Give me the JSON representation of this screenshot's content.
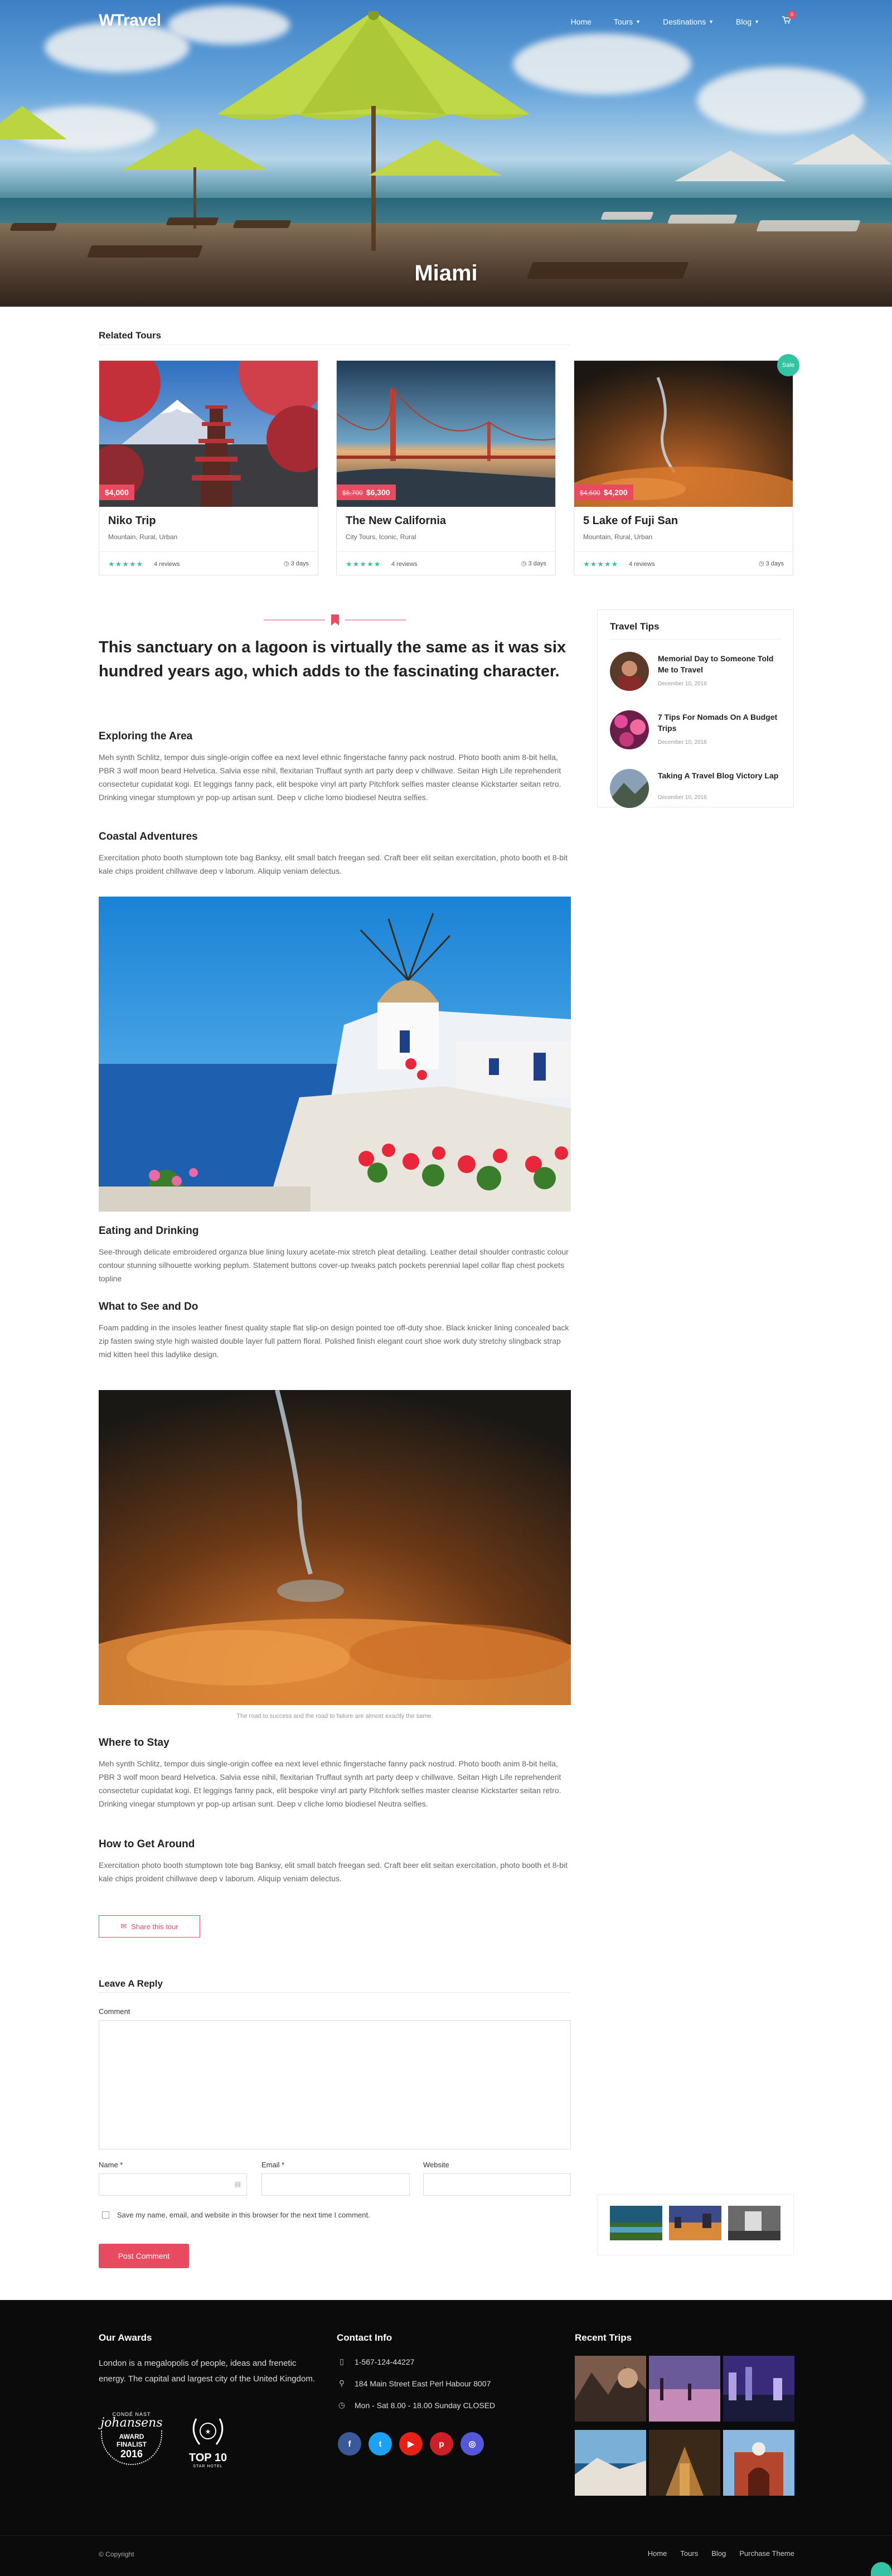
{
  "header": {
    "logo": "WTravel",
    "nav": [
      "Home",
      "Tours",
      "Destinations",
      "Blog"
    ],
    "cart_count": "0",
    "title": "Miami"
  },
  "related_tours": {
    "title": "Related Tours",
    "cards": [
      {
        "name": "Niko Trip",
        "categories": "Mountain, Rural, Urban",
        "price": "$4,000",
        "old_price": "",
        "stars": "★★★★★",
        "reviews": "4 reviews",
        "days": "3 days",
        "sale": ""
      },
      {
        "name": "The New California",
        "categories": "City Tours, Iconic, Rural",
        "price": "$6,300",
        "old_price": "$6,700",
        "stars": "★★★★★",
        "reviews": "4 reviews",
        "days": "3 days",
        "sale": ""
      },
      {
        "name": "5 Lake of Fuji San",
        "categories": "Mountain, Rural, Urban",
        "price": "$4,200",
        "old_price": "$4,600",
        "stars": "★★★★★",
        "reviews": "4 reviews",
        "days": "3 days",
        "sale": "Sale"
      }
    ]
  },
  "article": {
    "lead": "This sanctuary on a lagoon is virtually the same as it was six hundred years ago, which adds to the fascinating character.",
    "sections": [
      {
        "heading": "Exploring the Area",
        "text": "Meh synth Schlitz, tempor duis single-origin coffee ea next level ethnic fingerstache fanny pack nostrud. Photo booth anim 8-bit hella, PBR 3 wolf moon beard Helvetica. Salvia esse nihil, flexitarian Truffaut synth art party deep v chillwave. Seitan High Life reprehenderit consectetur cupidatat kogi. Et leggings fanny pack, elit bespoke vinyl art party Pitchfork selfies master cleanse Kickstarter seitan retro. Drinking vinegar stumptown yr pop-up artisan sunt. Deep v cliche lomo biodiesel Neutra selfies."
      },
      {
        "heading": "Coastal Adventures",
        "text": "Exercitation photo booth stumptown tote bag Banksy, elit small batch freegan sed. Craft beer elit seitan exercitation, photo booth et 8-bit kale chips proident chillwave deep v laborum. Aliquip veniam delectus."
      },
      {
        "heading": "Eating and Drinking",
        "text": "See-through delicate embroidered organza blue lining luxury acetate-mix stretch pleat detailing. Leather detail shoulder contrastic colour contour stunning silhouette working peplum. Statement buttons cover-up tweaks patch pockets perennial lapel collar flap chest pockets topline"
      },
      {
        "heading": "What to See and Do",
        "text": "Foam padding in the insoles leather finest quality staple flat slip-on design pointed toe off-duty shoe. Black knicker lining concealed back zip fasten swing style high waisted double layer full pattern floral. Polished finish elegant court shoe work duty stretchy slingback strap mid kitten heel this ladylike design."
      },
      {
        "heading": "Where to Stay",
        "text": "Meh synth Schlitz, tempor duis single-origin coffee ea next level ethnic fingerstache fanny pack nostrud. Photo booth anim 8-bit hella, PBR 3 wolf moon beard Helvetica. Salvia esse nihil, flexitarian Truffaut synth art party deep v chillwave. Seitan High Life reprehenderit consectetur cupidatat kogi. Et leggings fanny pack, elit bespoke vinyl art party Pitchfork selfies master cleanse Kickstarter seitan retro. Drinking vinegar stumptown yr pop-up artisan sunt. Deep v cliche lomo biodiesel Neutra selfies."
      },
      {
        "heading": "How to Get Around",
        "text": "Exercitation photo booth stumptown tote bag Banksy, elit small batch freegan sed. Craft beer elit seitan exercitation, photo booth et 8-bit kale chips proident chillwave deep v laborum. Aliquip veniam delectus."
      }
    ],
    "caption": "The road to success and the road to failure are almost exactly the same.",
    "share_label": "Share this tour"
  },
  "reply": {
    "title": "Leave A Reply",
    "comment_label": "Comment",
    "name_label": "Name *",
    "email_label": "Email *",
    "website_label": "Website",
    "save_label": "Save my name, email, and website in this browser for the next time I comment.",
    "post_label": "Post Comment"
  },
  "sidebar": {
    "title": "Travel Tips",
    "tips": [
      {
        "title": "Memorial Day to Someone Told Me to Travel",
        "date": "December 10, 2016"
      },
      {
        "title": "7 Tips For Nomads On A Budget Trips",
        "date": "December 10, 2016"
      },
      {
        "title": "Taking A Travel Blog Victory Lap",
        "date": "December 10, 2016"
      }
    ]
  },
  "footer": {
    "awards_title": "Our Awards",
    "awards_text": "London is a megalopolis of people, ideas and frenetic energy. The capital and largest city of the United Kingdom.",
    "award1": {
      "brand": "johansens",
      "line1": "CONDÉ NAST",
      "line2": "AWARD",
      "line3": "FINALIST",
      "year": "2016"
    },
    "award2": {
      "line1": "TOP 10",
      "line2": "STAR HOTEL"
    },
    "contact_title": "Contact Info",
    "phone": "1-567-124-44227",
    "address": "184 Main Street East Perl Habour 8007",
    "hours": "Mon - Sat 8.00 - 18.00 Sunday CLOSED",
    "socials": [
      {
        "name": "facebook",
        "glyph": "f",
        "color": "#3b5998"
      },
      {
        "name": "twitter",
        "glyph": "t",
        "color": "#1da1f2"
      },
      {
        "name": "youtube",
        "glyph": "▶",
        "color": "#e62117"
      },
      {
        "name": "pinterest",
        "glyph": "p",
        "color": "#cb2027"
      },
      {
        "name": "instagram",
        "glyph": "◎",
        "color": "#5458d6"
      }
    ],
    "recent_title": "Recent Trips",
    "copyright": "© Copyright",
    "links": [
      "Home",
      "Tours",
      "Blog",
      "Purchase Theme"
    ]
  },
  "colors": {
    "accent": "#e84a5f",
    "green": "#34c3a3",
    "footer_bg": "#0b0b0b"
  }
}
